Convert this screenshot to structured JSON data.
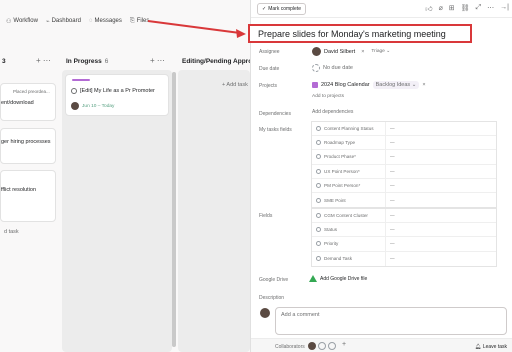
{
  "nav": {
    "items": [
      {
        "icon": "workflow-icon",
        "label": "Workflow"
      },
      {
        "icon": "dashboard-icon",
        "label": "Dashboard"
      },
      {
        "icon": "messages-icon",
        "label": "Messages"
      },
      {
        "icon": "files-icon",
        "label": "Files"
      }
    ]
  },
  "board": {
    "col1_count": "3",
    "col2": {
      "title": "In Progress",
      "count": "6"
    },
    "col3": {
      "title": "Editing/Pending Approv"
    },
    "cards_left": [
      "Placed preordea...",
      "ent/download",
      "ger hiring processes",
      "fflict resolution"
    ],
    "in_progress_card": {
      "title": "[Edit] My Life as a Pr Promoter",
      "date": "Jun 10 – Today"
    },
    "add_task": "d task",
    "add_task2": "+ Add task"
  },
  "pane": {
    "mark_complete": "Mark complete",
    "title": "Prepare slides for Monday's marketing meeting",
    "labels": {
      "assignee": "Assignee",
      "due_date": "Due date",
      "projects": "Projects",
      "dependencies": "Dependencies",
      "my_fields": "My tasks fields",
      "fields": "Fields",
      "google_drive": "Google Drive",
      "description": "Description"
    },
    "assignee_name": "David Silbert",
    "assignee_remove": "×",
    "triage": "Triage",
    "due_date_value": "No due date",
    "project_name": "2024 Blog Calendar",
    "project_section": "Backlog Ideas",
    "add_to_projects": "Add to projects",
    "add_dependencies": "Add dependencies",
    "my_fields": [
      {
        "name": "Content Planning Status",
        "value": "—"
      },
      {
        "name": "Roadmap Type",
        "value": "—"
      },
      {
        "name": "Product Phase*",
        "value": "—"
      },
      {
        "name": "UX Point Person*",
        "value": "—"
      },
      {
        "name": "PM Point Person*",
        "value": "—"
      },
      {
        "name": "SME Point",
        "value": "—"
      }
    ],
    "fields": [
      {
        "name": "CGM Content Cluster",
        "value": "—"
      },
      {
        "name": "Status",
        "value": "—"
      },
      {
        "name": "Priority",
        "value": "—"
      },
      {
        "name": "Demand Task",
        "value": "—"
      }
    ],
    "google_drive_action": "Add Google Drive file",
    "comment_placeholder": "Add a comment",
    "collaborators": "Collaborators",
    "leave_task": "Leave task"
  },
  "colors": {
    "annotation_red": "#d9383a",
    "accent_purple": "#b36bd4",
    "accent_green": "#58a182"
  }
}
